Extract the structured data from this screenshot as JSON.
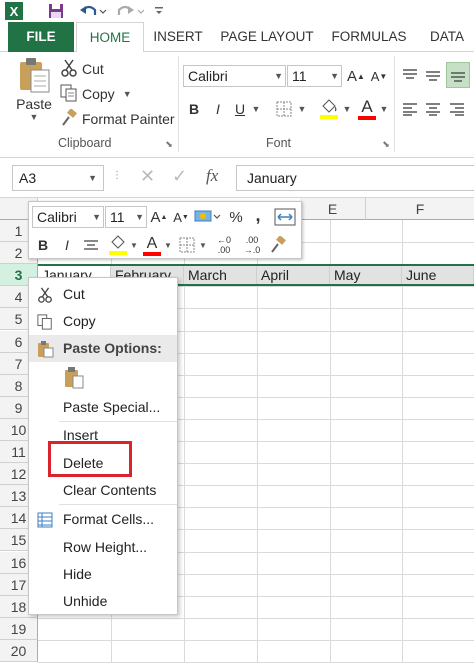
{
  "qat": {
    "icons": [
      "excel-logo-icon",
      "save-icon",
      "undo-icon",
      "redo-icon",
      "customize-qat-icon"
    ],
    "excel_logo_letter": "X"
  },
  "tabs": [
    "FILE",
    "HOME",
    "INSERT",
    "PAGE LAYOUT",
    "FORMULAS",
    "DATA"
  ],
  "clipboard": {
    "paste_label": "Paste",
    "cut_label": "Cut",
    "copy_label": "Copy",
    "format_painter_label": "Format Painter",
    "group_label": "Clipboard"
  },
  "font": {
    "font_name": "Calibri",
    "font_size": "11",
    "group_label": "Font",
    "bold": "B",
    "italic": "I",
    "underline": "U",
    "font_color_letter": "A",
    "grow_letter": "A",
    "shrink_letter": "A"
  },
  "formula_bar": {
    "name_box": "A3",
    "fx_label": "fx",
    "value": "January"
  },
  "grid": {
    "columns": [
      "E",
      "F"
    ],
    "rows": [
      "1",
      "2",
      "3",
      "4",
      "5",
      "6",
      "7",
      "8",
      "9",
      "10",
      "11",
      "12",
      "13",
      "14",
      "15",
      "16",
      "17",
      "18",
      "19",
      "20"
    ],
    "row3_values": [
      "January",
      "February",
      "March",
      "April",
      "May",
      "June"
    ],
    "selected_row": "3"
  },
  "mini_toolbar": {
    "font_name": "Calibri",
    "font_size": "11",
    "percent": "%",
    "comma": ",",
    "bold": "B",
    "italic": "I",
    "inc_decimal": "+.0\n.00",
    "dec_decimal": ".00\n+.0",
    "inc_decimal_top": "←0",
    "inc_decimal_bottom": ".00",
    "dec_decimal_top": ".00",
    "dec_decimal_bottom": "→.0"
  },
  "context_menu": {
    "items": [
      {
        "label": "Cut",
        "icon": "scissors-icon"
      },
      {
        "label": "Copy",
        "icon": "copy-icon"
      },
      {
        "label": "Paste Options:",
        "icon": "paste-icon"
      },
      {
        "label": "Paste Special...",
        "icon": ""
      },
      {
        "label": "Insert",
        "icon": ""
      },
      {
        "label": "Delete",
        "icon": ""
      },
      {
        "label": "Clear Contents",
        "icon": ""
      },
      {
        "label": "Format Cells...",
        "icon": "format-cells-icon"
      },
      {
        "label": "Row Height...",
        "icon": ""
      },
      {
        "label": "Hide",
        "icon": ""
      },
      {
        "label": "Unhide",
        "icon": ""
      }
    ],
    "highlighted_item": "Delete"
  },
  "colors": {
    "excel_green": "#217346",
    "highlight_red": "#d9232d",
    "fill_yellow": "#ffff00",
    "font_red": "#ff0000"
  }
}
